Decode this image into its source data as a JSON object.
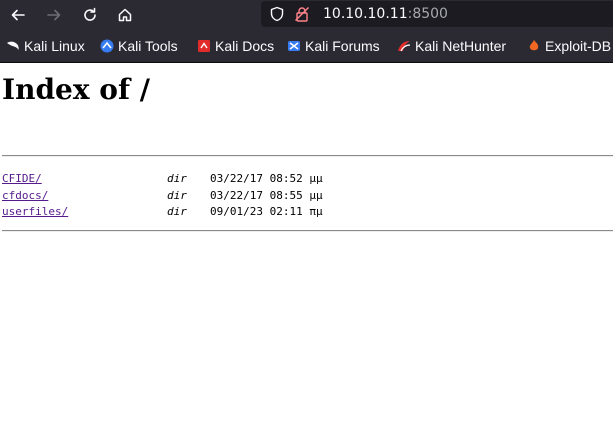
{
  "browser": {
    "url_host": "10.10.10.11",
    "url_port": ":8500",
    "bookmarks": [
      {
        "label": "Kali Linux",
        "icon": "kali-dragon-icon"
      },
      {
        "label": "Kali Tools",
        "icon": "kali-tools-icon"
      },
      {
        "label": "Kali Docs",
        "icon": "kali-docs-icon"
      },
      {
        "label": "Kali Forums",
        "icon": "kali-forums-icon"
      },
      {
        "label": "Kali NetHunter",
        "icon": "kali-nethunter-icon"
      },
      {
        "label": "Exploit-DB",
        "icon": "exploit-db-icon"
      }
    ]
  },
  "page": {
    "title": "Index of /",
    "entries": [
      {
        "name": "CFIDE/",
        "type": "dir",
        "date": "03/22/17 08:52 μμ"
      },
      {
        "name": "cfdocs/",
        "type": "dir",
        "date": "03/22/17 08:55 μμ"
      },
      {
        "name": "userfiles/",
        "type": "dir",
        "date": "09/01/23 02:11 πμ"
      }
    ]
  },
  "colors": {
    "chrome_bg": "#2b2a33",
    "urlbar_bg": "#1c1b22",
    "link_visited": "#551a8b"
  }
}
